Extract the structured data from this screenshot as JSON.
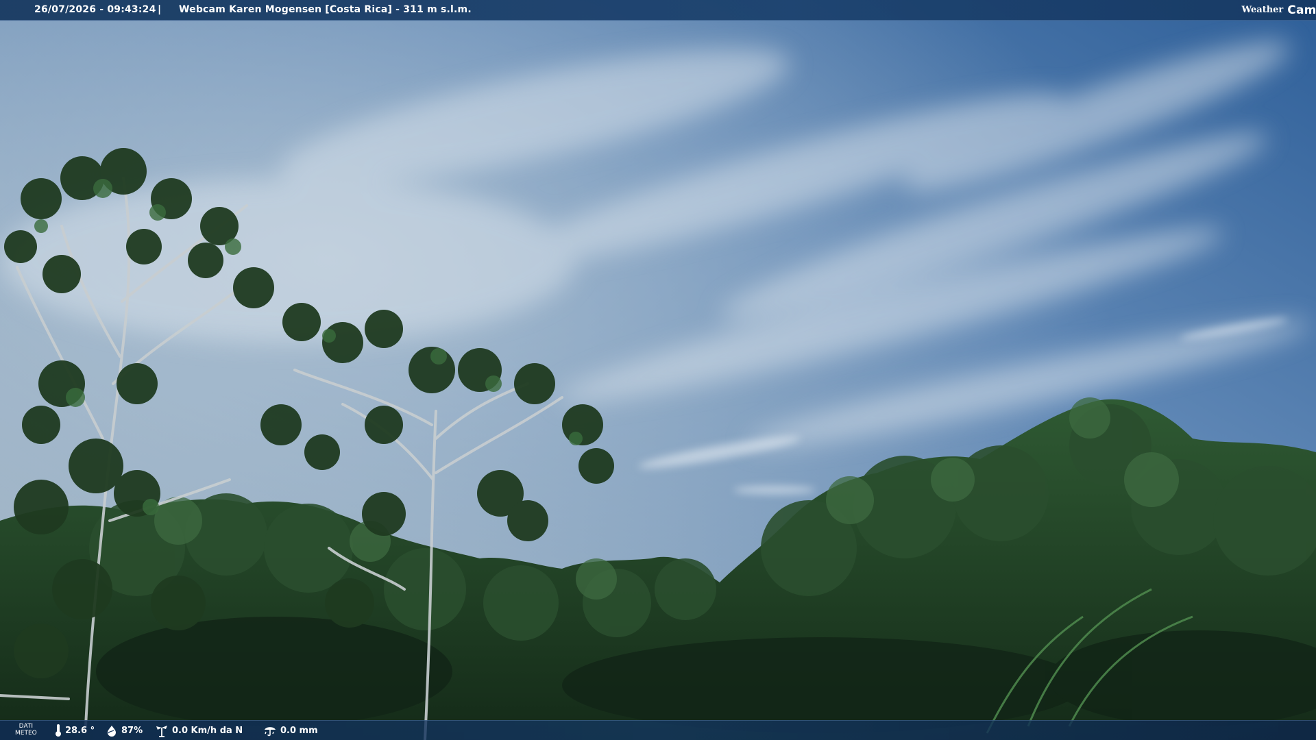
{
  "header": {
    "timestamp": "26/07/2026 - 09:43:24",
    "separator": "|",
    "title": "Webcam Karen Mogensen [Costa Rica]  - 311 m s.l.m."
  },
  "logo": {
    "text_left": "Weather",
    "text_right": "Cam"
  },
  "weather": {
    "label_line1": "DATI",
    "label_line2": "METEO",
    "temperature": "28.6 °",
    "humidity": "87%",
    "wind": "0.0 Km/h da N",
    "rain": "0.0 mm"
  },
  "icons": {
    "temperature": "thermometer-icon",
    "humidity": "humidity-drop-icon",
    "wind": "wind-vane-icon",
    "rain": "rain-gauge-icon"
  },
  "colors": {
    "bar": "#15365e",
    "text": "#ffffff",
    "sky_top": "#3f6fa6",
    "sky_bottom": "#a9bccb",
    "foliage": "#1f3d22"
  }
}
